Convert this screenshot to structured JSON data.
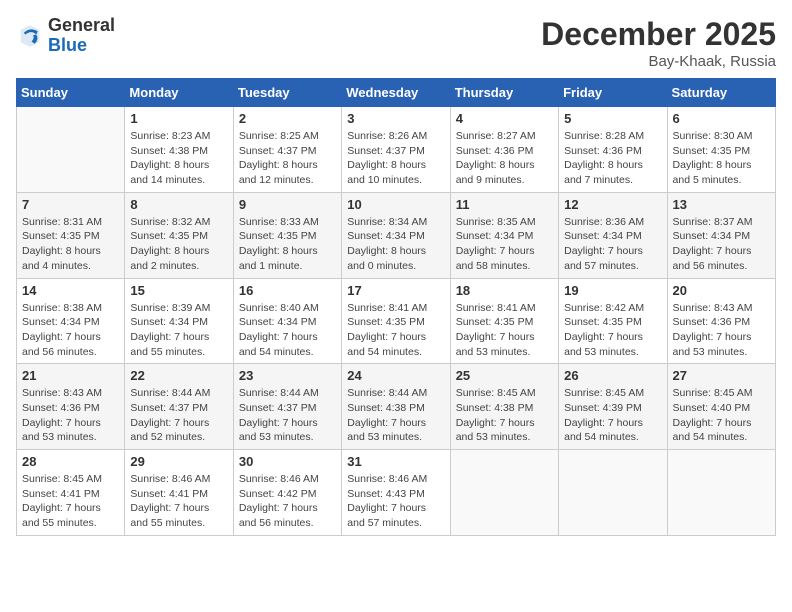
{
  "logo": {
    "general": "General",
    "blue": "Blue"
  },
  "title": "December 2025",
  "location": "Bay-Khaak, Russia",
  "weekdays": [
    "Sunday",
    "Monday",
    "Tuesday",
    "Wednesday",
    "Thursday",
    "Friday",
    "Saturday"
  ],
  "weeks": [
    [
      {
        "day": "",
        "info": ""
      },
      {
        "day": "1",
        "info": "Sunrise: 8:23 AM\nSunset: 4:38 PM\nDaylight: 8 hours\nand 14 minutes."
      },
      {
        "day": "2",
        "info": "Sunrise: 8:25 AM\nSunset: 4:37 PM\nDaylight: 8 hours\nand 12 minutes."
      },
      {
        "day": "3",
        "info": "Sunrise: 8:26 AM\nSunset: 4:37 PM\nDaylight: 8 hours\nand 10 minutes."
      },
      {
        "day": "4",
        "info": "Sunrise: 8:27 AM\nSunset: 4:36 PM\nDaylight: 8 hours\nand 9 minutes."
      },
      {
        "day": "5",
        "info": "Sunrise: 8:28 AM\nSunset: 4:36 PM\nDaylight: 8 hours\nand 7 minutes."
      },
      {
        "day": "6",
        "info": "Sunrise: 8:30 AM\nSunset: 4:35 PM\nDaylight: 8 hours\nand 5 minutes."
      }
    ],
    [
      {
        "day": "7",
        "info": "Sunrise: 8:31 AM\nSunset: 4:35 PM\nDaylight: 8 hours\nand 4 minutes."
      },
      {
        "day": "8",
        "info": "Sunrise: 8:32 AM\nSunset: 4:35 PM\nDaylight: 8 hours\nand 2 minutes."
      },
      {
        "day": "9",
        "info": "Sunrise: 8:33 AM\nSunset: 4:35 PM\nDaylight: 8 hours\nand 1 minute."
      },
      {
        "day": "10",
        "info": "Sunrise: 8:34 AM\nSunset: 4:34 PM\nDaylight: 8 hours\nand 0 minutes."
      },
      {
        "day": "11",
        "info": "Sunrise: 8:35 AM\nSunset: 4:34 PM\nDaylight: 7 hours\nand 58 minutes."
      },
      {
        "day": "12",
        "info": "Sunrise: 8:36 AM\nSunset: 4:34 PM\nDaylight: 7 hours\nand 57 minutes."
      },
      {
        "day": "13",
        "info": "Sunrise: 8:37 AM\nSunset: 4:34 PM\nDaylight: 7 hours\nand 56 minutes."
      }
    ],
    [
      {
        "day": "14",
        "info": "Sunrise: 8:38 AM\nSunset: 4:34 PM\nDaylight: 7 hours\nand 56 minutes."
      },
      {
        "day": "15",
        "info": "Sunrise: 8:39 AM\nSunset: 4:34 PM\nDaylight: 7 hours\nand 55 minutes."
      },
      {
        "day": "16",
        "info": "Sunrise: 8:40 AM\nSunset: 4:34 PM\nDaylight: 7 hours\nand 54 minutes."
      },
      {
        "day": "17",
        "info": "Sunrise: 8:41 AM\nSunset: 4:35 PM\nDaylight: 7 hours\nand 54 minutes."
      },
      {
        "day": "18",
        "info": "Sunrise: 8:41 AM\nSunset: 4:35 PM\nDaylight: 7 hours\nand 53 minutes."
      },
      {
        "day": "19",
        "info": "Sunrise: 8:42 AM\nSunset: 4:35 PM\nDaylight: 7 hours\nand 53 minutes."
      },
      {
        "day": "20",
        "info": "Sunrise: 8:43 AM\nSunset: 4:36 PM\nDaylight: 7 hours\nand 53 minutes."
      }
    ],
    [
      {
        "day": "21",
        "info": "Sunrise: 8:43 AM\nSunset: 4:36 PM\nDaylight: 7 hours\nand 53 minutes."
      },
      {
        "day": "22",
        "info": "Sunrise: 8:44 AM\nSunset: 4:37 PM\nDaylight: 7 hours\nand 52 minutes."
      },
      {
        "day": "23",
        "info": "Sunrise: 8:44 AM\nSunset: 4:37 PM\nDaylight: 7 hours\nand 53 minutes."
      },
      {
        "day": "24",
        "info": "Sunrise: 8:44 AM\nSunset: 4:38 PM\nDaylight: 7 hours\nand 53 minutes."
      },
      {
        "day": "25",
        "info": "Sunrise: 8:45 AM\nSunset: 4:38 PM\nDaylight: 7 hours\nand 53 minutes."
      },
      {
        "day": "26",
        "info": "Sunrise: 8:45 AM\nSunset: 4:39 PM\nDaylight: 7 hours\nand 54 minutes."
      },
      {
        "day": "27",
        "info": "Sunrise: 8:45 AM\nSunset: 4:40 PM\nDaylight: 7 hours\nand 54 minutes."
      }
    ],
    [
      {
        "day": "28",
        "info": "Sunrise: 8:45 AM\nSunset: 4:41 PM\nDaylight: 7 hours\nand 55 minutes."
      },
      {
        "day": "29",
        "info": "Sunrise: 8:46 AM\nSunset: 4:41 PM\nDaylight: 7 hours\nand 55 minutes."
      },
      {
        "day": "30",
        "info": "Sunrise: 8:46 AM\nSunset: 4:42 PM\nDaylight: 7 hours\nand 56 minutes."
      },
      {
        "day": "31",
        "info": "Sunrise: 8:46 AM\nSunset: 4:43 PM\nDaylight: 7 hours\nand 57 minutes."
      },
      {
        "day": "",
        "info": ""
      },
      {
        "day": "",
        "info": ""
      },
      {
        "day": "",
        "info": ""
      }
    ]
  ]
}
